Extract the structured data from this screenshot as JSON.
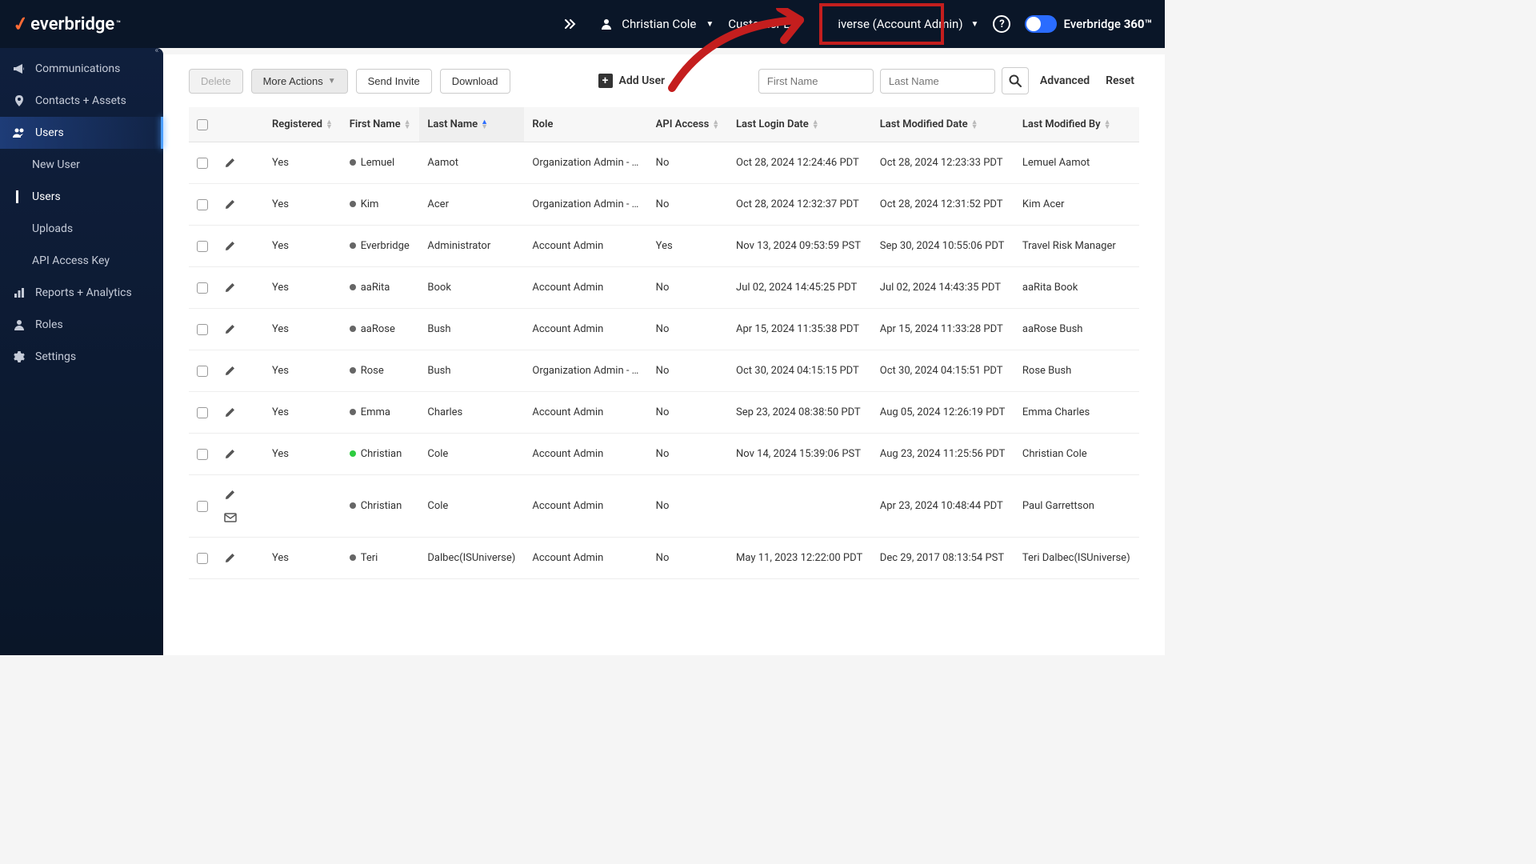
{
  "topbar": {
    "brand": "everbridge",
    "tm": "™",
    "user_name": "Christian Cole",
    "org_label_left": "Customer L",
    "org_label_right": "iverse (Account Admin)",
    "product_prefix": "Everbridge ",
    "product_bold": "360™"
  },
  "sidebar": {
    "items": [
      {
        "label": "Communications"
      },
      {
        "label": "Contacts + Assets"
      },
      {
        "label": "Users"
      },
      {
        "label": "Reports + Analytics"
      },
      {
        "label": "Roles"
      },
      {
        "label": "Settings"
      }
    ],
    "sub_items": [
      {
        "label": "New User"
      },
      {
        "label": "Users"
      },
      {
        "label": "Uploads"
      },
      {
        "label": "API Access Key"
      }
    ]
  },
  "toolbar": {
    "delete": "Delete",
    "more_actions": "More Actions",
    "send_invite": "Send Invite",
    "download": "Download",
    "add_user": "Add User",
    "first_name_ph": "First Name",
    "last_name_ph": "Last Name",
    "advanced": "Advanced",
    "reset": "Reset"
  },
  "columns": {
    "registered": "Registered",
    "first_name": "First Name",
    "last_name": "Last Name",
    "role": "Role",
    "api_access": "API Access",
    "last_login": "Last Login Date",
    "last_modified": "Last Modified Date",
    "last_modified_by": "Last Modified By"
  },
  "rows": [
    {
      "registered": "Yes",
      "dot": "gray",
      "first": "Lemuel",
      "last": "Aamot",
      "role": "Organization Admin - …",
      "api": "No",
      "login": "Oct 28, 2024 12:24:46 PDT",
      "modified": "Oct 28, 2024 12:23:33 PDT",
      "by": "Lemuel Aamot",
      "mail": false
    },
    {
      "registered": "Yes",
      "dot": "gray",
      "first": "Kim",
      "last": "Acer",
      "role": "Organization Admin - …",
      "api": "No",
      "login": "Oct 28, 2024 12:32:37 PDT",
      "modified": "Oct 28, 2024 12:31:52 PDT",
      "by": "Kim Acer",
      "mail": false
    },
    {
      "registered": "Yes",
      "dot": "gray",
      "first": "Everbridge",
      "last": "Administrator",
      "role": "Account Admin",
      "api": "Yes",
      "login": "Nov 13, 2024 09:53:59 PST",
      "modified": "Sep 30, 2024 10:55:06 PDT",
      "by": "Travel Risk Manager",
      "mail": false
    },
    {
      "registered": "Yes",
      "dot": "gray",
      "first": "aaRita",
      "last": "Book",
      "role": "Account Admin",
      "api": "No",
      "login": "Jul 02, 2024 14:45:25 PDT",
      "modified": "Jul 02, 2024 14:43:35 PDT",
      "by": "aaRita Book",
      "mail": false
    },
    {
      "registered": "Yes",
      "dot": "gray",
      "first": "aaRose",
      "last": "Bush",
      "role": "Account Admin",
      "api": "No",
      "login": "Apr 15, 2024 11:35:38 PDT",
      "modified": "Apr 15, 2024 11:33:28 PDT",
      "by": "aaRose Bush",
      "mail": false
    },
    {
      "registered": "Yes",
      "dot": "gray",
      "first": "Rose",
      "last": "Bush",
      "role": "Organization Admin - …",
      "api": "No",
      "login": "Oct 30, 2024 04:15:15 PDT",
      "modified": "Oct 30, 2024 04:15:51 PDT",
      "by": "Rose Bush",
      "mail": false
    },
    {
      "registered": "Yes",
      "dot": "gray",
      "first": "Emma",
      "last": "Charles",
      "role": "Account Admin",
      "api": "No",
      "login": "Sep 23, 2024 08:38:50 PDT",
      "modified": "Aug 05, 2024 12:26:19 PDT",
      "by": "Emma Charles",
      "mail": false
    },
    {
      "registered": "Yes",
      "dot": "green",
      "first": "Christian",
      "last": "Cole",
      "role": "Account Admin",
      "api": "No",
      "login": "Nov 14, 2024 15:39:06 PST",
      "modified": "Aug 23, 2024 11:25:56 PDT",
      "by": "Christian Cole",
      "mail": false
    },
    {
      "registered": "",
      "dot": "gray",
      "first": "Christian",
      "last": "Cole",
      "role": "Account Admin",
      "api": "No",
      "login": "",
      "modified": "Apr 23, 2024 10:48:44 PDT",
      "by": "Paul Garrettson",
      "mail": true
    },
    {
      "registered": "Yes",
      "dot": "gray",
      "first": "Teri",
      "last": "Dalbec(ISUniverse)",
      "role": "Account Admin",
      "api": "No",
      "login": "May 11, 2023 12:22:00 PDT",
      "modified": "Dec 29, 2017 08:13:54 PST",
      "by": "Teri Dalbec(ISUniverse)",
      "mail": false
    }
  ]
}
